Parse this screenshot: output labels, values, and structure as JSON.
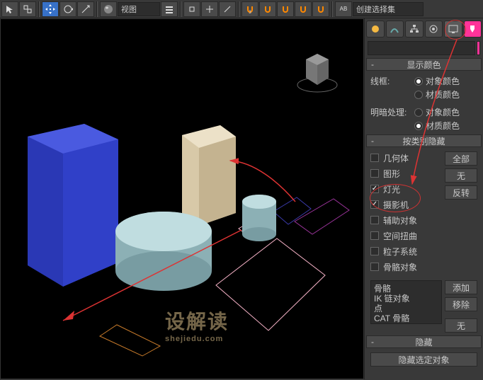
{
  "toolbar": {
    "view_dropdown": "视图",
    "selection_dropdown": "创建选择集"
  },
  "panel": {
    "section_display": {
      "title": "显示颜色",
      "wireframe_label": "线框:",
      "shaded_label": "明暗处理:",
      "opt_object_color": "对象颜色",
      "opt_material_color": "材质颜色"
    },
    "section_hide_category": {
      "title": "按类别隐藏",
      "items": [
        {
          "label": "几何体",
          "checked": false
        },
        {
          "label": "图形",
          "checked": false
        },
        {
          "label": "灯光",
          "checked": true
        },
        {
          "label": "摄影机",
          "checked": true
        },
        {
          "label": "辅助对象",
          "checked": false
        },
        {
          "label": "空间扭曲",
          "checked": false
        },
        {
          "label": "粒子系统",
          "checked": false
        },
        {
          "label": "骨骼对象",
          "checked": false
        }
      ],
      "btn_all": "全部",
      "btn_none": "无",
      "btn_invert": "反转"
    },
    "listbox": {
      "items": [
        "骨骼",
        "IK 链对象",
        "点",
        "CAT 骨骼"
      ]
    },
    "btn_add": "添加",
    "btn_remove": "移除",
    "btn_none2": "无",
    "section_hide": {
      "title": "隐藏",
      "btn_hide_selected": "隐藏选定对象"
    }
  },
  "watermark": {
    "main": "设解读",
    "sub": "shejiedu.com"
  }
}
